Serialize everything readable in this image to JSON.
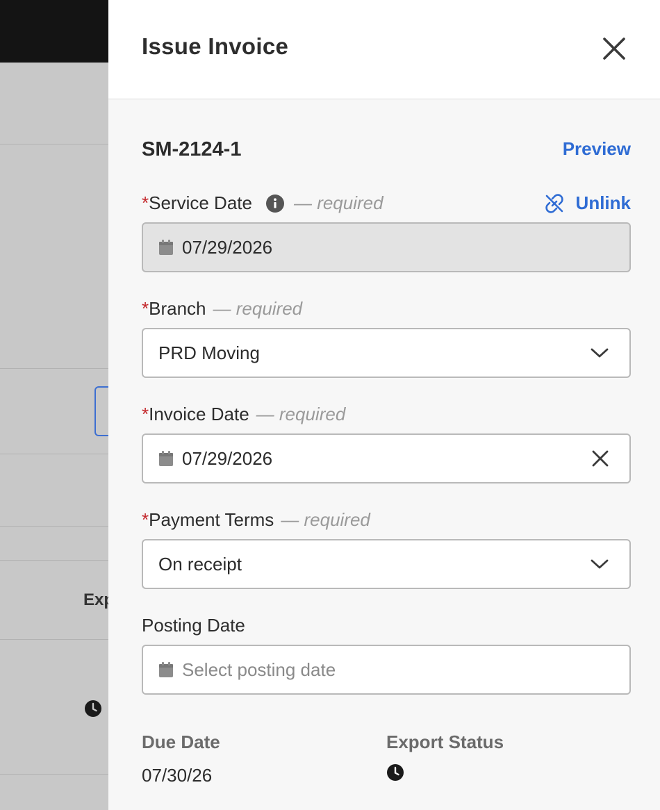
{
  "background": {
    "partial_text": "Exp"
  },
  "drawer": {
    "title": "Issue Invoice",
    "invoice_id": "SM-2124-1",
    "preview_label": "Preview",
    "unlink_label": "Unlink",
    "fields": {
      "service_date": {
        "label": "Service Date",
        "hint": "— required",
        "value": "07/29/2026"
      },
      "branch": {
        "label": "Branch",
        "hint": "— required",
        "value": "PRD Moving"
      },
      "invoice_date": {
        "label": "Invoice Date",
        "hint": "— required",
        "value": "07/29/2026"
      },
      "payment_terms": {
        "label": "Payment Terms",
        "hint": "— required",
        "value": "On receipt"
      },
      "posting_date": {
        "label": "Posting Date",
        "placeholder": "Select posting date"
      }
    },
    "summary": {
      "due_date_label": "Due Date",
      "due_date_value": "07/30/26",
      "export_status_label": "Export Status"
    }
  },
  "colors": {
    "accent": "#2f6cd4",
    "required": "#c3262a",
    "hint": "#9a9a9a"
  },
  "icons": [
    "close-icon",
    "info-icon",
    "unlink-icon",
    "calendar-icon",
    "chevron-down-icon",
    "clear-icon",
    "clock-icon"
  ]
}
